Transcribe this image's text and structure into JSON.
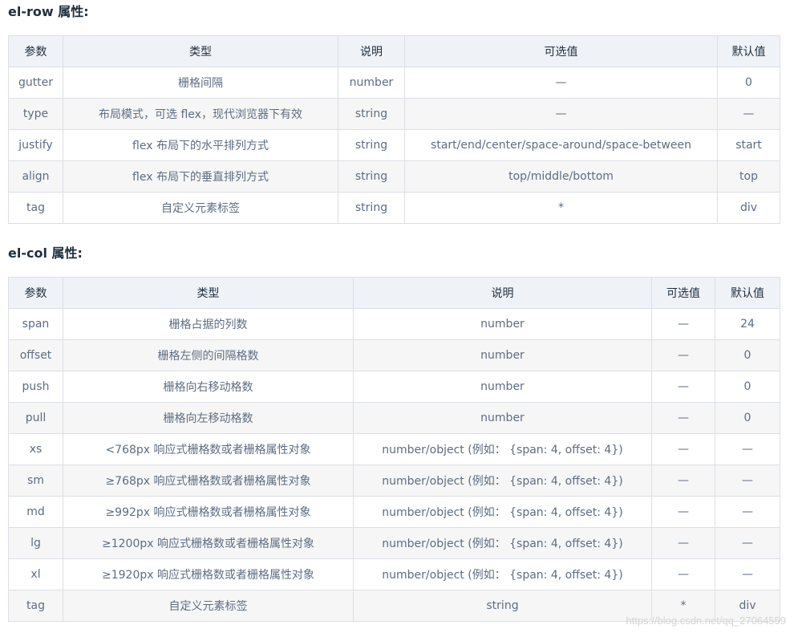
{
  "row_section": {
    "title": "el-row 属性:",
    "headers": [
      "参数",
      "类型",
      "说明",
      "可选值",
      "默认值"
    ],
    "rows": [
      [
        "gutter",
        "栅格间隔",
        "number",
        "—",
        "0"
      ],
      [
        "type",
        "布局模式，可选 flex，现代浏览器下有效",
        "string",
        "—",
        "—"
      ],
      [
        "justify",
        "flex 布局下的水平排列方式",
        "string",
        "start/end/center/space-around/space-between",
        "start"
      ],
      [
        "align",
        "flex 布局下的垂直排列方式",
        "string",
        "top/middle/bottom",
        "top"
      ],
      [
        "tag",
        "自定义元素标签",
        "string",
        "*",
        "div"
      ]
    ]
  },
  "col_section": {
    "title": "el-col 属性:",
    "headers": [
      "参数",
      "类型",
      "说明",
      "可选值",
      "默认值"
    ],
    "rows": [
      [
        "span",
        "栅格占据的列数",
        "number",
        "—",
        "24"
      ],
      [
        "offset",
        "栅格左侧的间隔格数",
        "number",
        "—",
        "0"
      ],
      [
        "push",
        "栅格向右移动格数",
        "number",
        "—",
        "0"
      ],
      [
        "pull",
        "栅格向左移动格数",
        "number",
        "—",
        "0"
      ],
      [
        "xs",
        "<768px 响应式栅格数或者栅格属性对象",
        "number/object (例如： {span: 4, offset: 4})",
        "—",
        "—"
      ],
      [
        "sm",
        "≥768px 响应式栅格数或者栅格属性对象",
        "number/object (例如： {span: 4, offset: 4})",
        "—",
        "—"
      ],
      [
        "md",
        "≥992px 响应式栅格数或者栅格属性对象",
        "number/object (例如： {span: 4, offset: 4})",
        "—",
        "—"
      ],
      [
        "lg",
        "≥1200px 响应式栅格数或者栅格属性对象",
        "number/object (例如： {span: 4, offset: 4})",
        "—",
        "—"
      ],
      [
        "xl",
        "≥1920px 响应式栅格数或者栅格属性对象",
        "number/object (例如： {span: 4, offset: 4})",
        "—",
        "—"
      ],
      [
        "tag",
        "自定义元素标签",
        "string",
        "*",
        "div"
      ]
    ]
  },
  "watermark": "https://blog.csdn.net/qq_27064559"
}
